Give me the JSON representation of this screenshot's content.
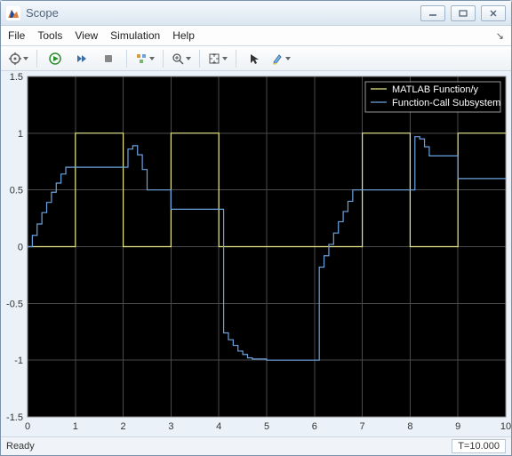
{
  "window": {
    "title": "Scope"
  },
  "menu": {
    "file": "File",
    "tools": "Tools",
    "view": "View",
    "simulation": "Simulation",
    "help": "Help"
  },
  "toolbar": {
    "icons": {
      "config": "gear-icon",
      "run": "run-icon",
      "step": "step-forward-icon",
      "stop": "stop-icon",
      "triggers": "triggers-icon",
      "zoom": "zoom-icon",
      "autoscale": "autoscale-icon",
      "cursor": "cursor-measure-icon",
      "highlight": "highlight-icon"
    }
  },
  "status": {
    "left": "Ready",
    "right": "T=10.000"
  },
  "chart_data": {
    "type": "line",
    "xlim": [
      0,
      10
    ],
    "ylim": [
      -1.5,
      1.5
    ],
    "xticks": [
      0,
      1,
      2,
      3,
      4,
      5,
      6,
      7,
      8,
      9,
      10
    ],
    "yticks": [
      -1.5,
      -1,
      -0.5,
      0,
      0.5,
      1,
      1.5
    ],
    "legend": {
      "position": "top-right",
      "entries": [
        "MATLAB Function/y",
        "Function-Call Subsystem"
      ]
    },
    "series": [
      {
        "name": "MATLAB Function/y",
        "color": "#e8e88a",
        "step": true,
        "x": [
          0,
          1,
          2,
          3,
          4,
          5,
          6,
          7,
          8,
          9,
          10
        ],
        "y": [
          0,
          1,
          0,
          1,
          0,
          0,
          0,
          1,
          0,
          1,
          1
        ]
      },
      {
        "name": "Function-Call Subsystem",
        "color": "#6ba3e0",
        "step": true,
        "x": [
          0,
          0.1,
          0.2,
          0.3,
          0.4,
          0.5,
          0.6,
          0.7,
          0.8,
          0.9,
          1.0,
          2.0,
          2.1,
          2.2,
          2.3,
          2.4,
          2.5,
          3.0,
          4.0,
          4.1,
          4.2,
          4.3,
          4.4,
          4.5,
          4.6,
          4.7,
          5.0,
          6.0,
          6.1,
          6.2,
          6.3,
          6.4,
          6.5,
          6.6,
          6.7,
          6.8,
          6.9,
          7.0,
          8.0,
          8.1,
          8.2,
          8.3,
          8.4,
          9.0,
          10.0
        ],
        "y": [
          0,
          0.1,
          0.2,
          0.3,
          0.39,
          0.48,
          0.56,
          0.64,
          0.7,
          0.7,
          0.7,
          0.7,
          0.86,
          0.89,
          0.81,
          0.68,
          0.5,
          0.33,
          0.33,
          -0.76,
          -0.82,
          -0.87,
          -0.92,
          -0.95,
          -0.98,
          -0.99,
          -1.0,
          -1.0,
          -0.18,
          -0.08,
          0.02,
          0.12,
          0.22,
          0.31,
          0.4,
          0.5,
          0.5,
          0.5,
          0.5,
          0.97,
          0.95,
          0.88,
          0.8,
          0.6,
          0.6
        ]
      }
    ]
  }
}
